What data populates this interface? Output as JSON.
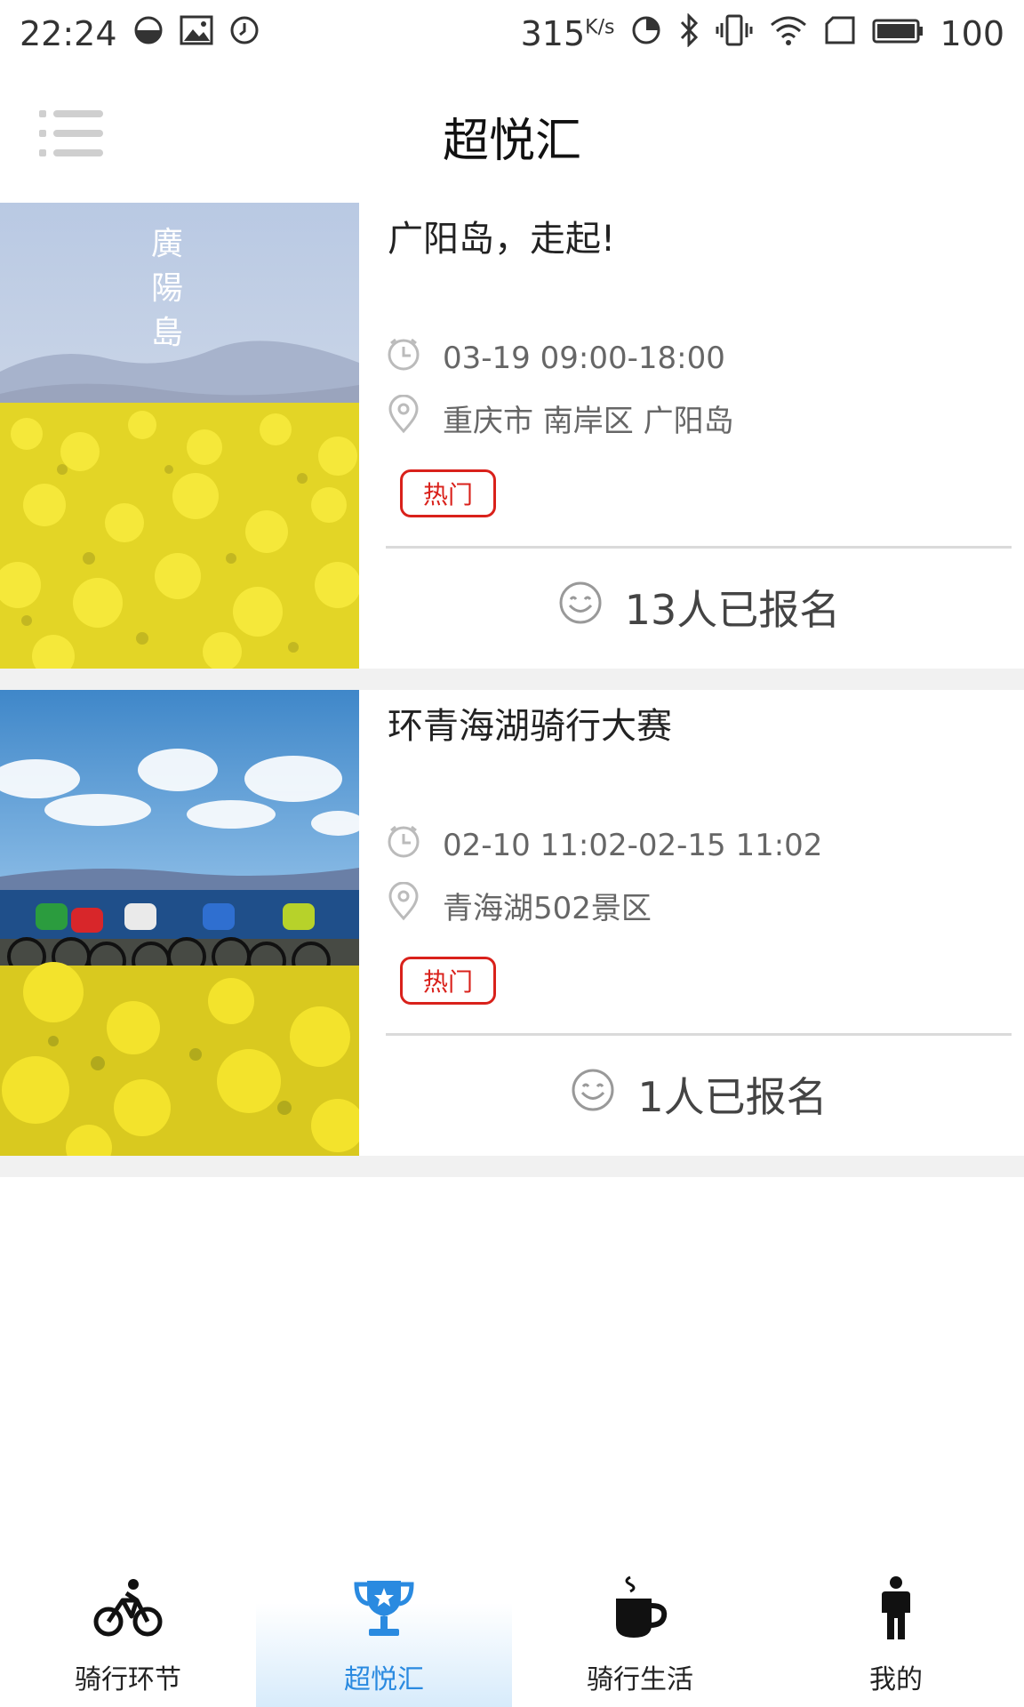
{
  "status_bar": {
    "time": "22:24",
    "speed": "315",
    "speed_unit": "K/s",
    "battery": "100",
    "icons": [
      "data-saver-icon",
      "image-icon",
      "clock-icon",
      "speed-indicator",
      "location-sync-icon",
      "bluetooth-icon",
      "vibrate-icon",
      "wifi-icon",
      "sim-icon",
      "battery-icon"
    ]
  },
  "header": {
    "title": "超悦汇",
    "menu_icon": "list-menu-icon"
  },
  "events": [
    {
      "title": "广阳岛，走起!",
      "time": "03-19 09:00-18:00",
      "location": "重庆市 南岸区 广阳岛",
      "badge": "热门",
      "signup": "13人已报名",
      "image": "rapeseed-field-guangyang-island",
      "image_text": "廣陽島"
    },
    {
      "title": "环青海湖骑行大赛",
      "time": "02-10 11:02-02-15 11:02",
      "location": "青海湖502景区",
      "badge": "热门",
      "signup": "1人已报名",
      "image": "cyclists-qinghai-lake"
    }
  ],
  "tabbar": {
    "active_index": 1,
    "tabs": [
      {
        "label": "骑行环节",
        "icon": "bicycle-icon"
      },
      {
        "label": "超悦汇",
        "icon": "trophy-icon"
      },
      {
        "label": "骑行生活",
        "icon": "coffee-cup-icon"
      },
      {
        "label": "我的",
        "icon": "person-icon"
      }
    ]
  },
  "colors": {
    "accent": "#2a8ae0",
    "badge": "#d9211b",
    "separator": "#f1f1f1"
  }
}
